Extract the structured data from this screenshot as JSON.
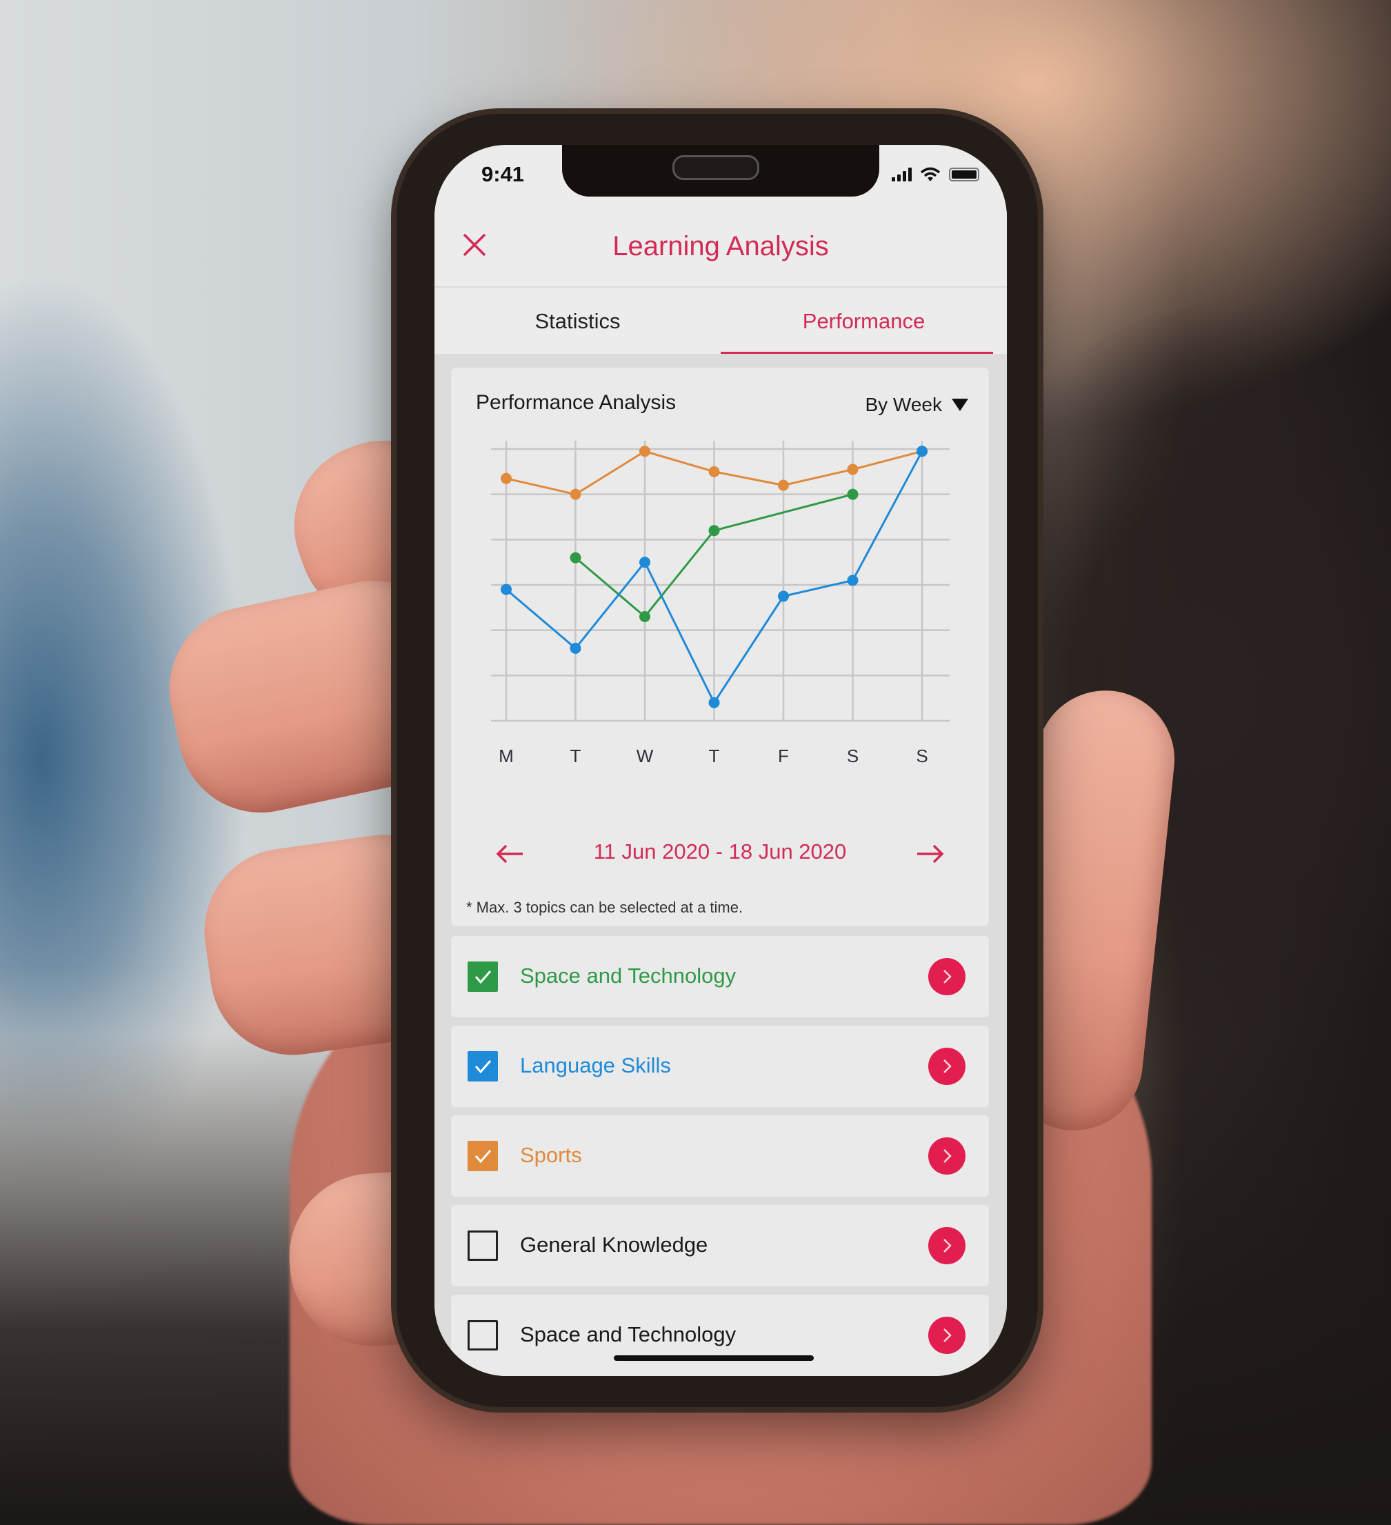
{
  "status_bar": {
    "time": "9:41"
  },
  "header": {
    "title": "Learning Analysis",
    "close_icon": "close-icon"
  },
  "tabs": [
    {
      "label": "Statistics",
      "active": false
    },
    {
      "label": "Performance",
      "active": true
    }
  ],
  "chart_card": {
    "title": "Performance Analysis",
    "range_select": {
      "selected": "By Week",
      "icon": "caret-down-icon"
    },
    "date_range": "11 Jun 2020 - 18 Jun 2020",
    "prev_icon": "arrow-left-icon",
    "next_icon": "arrow-right-icon",
    "note": "* Max. 3 topics can be selected at a time."
  },
  "colors": {
    "accent": "#d22b55",
    "button": "#e21d4f",
    "orange": "#e08a3c",
    "green": "#2f9a46",
    "blue": "#1f8ad8"
  },
  "chart_data": {
    "type": "line",
    "title": "Performance Analysis",
    "xlabel": "",
    "ylabel": "",
    "categories": [
      "M",
      "T",
      "W",
      "T",
      "F",
      "S",
      "S"
    ],
    "ylim": [
      0,
      6
    ],
    "grid": true,
    "y_tick_labels_shown": false,
    "series": [
      {
        "name": "Sports",
        "color": "#e08a3c",
        "values": [
          5.35,
          5.0,
          5.95,
          5.5,
          5.2,
          5.55,
          5.95
        ]
      },
      {
        "name": "Space and Technology",
        "color": "#2f9a46",
        "values": [
          null,
          3.6,
          2.3,
          4.2,
          null,
          5.0,
          null
        ]
      },
      {
        "name": "Language Skills",
        "color": "#1f8ad8",
        "values": [
          2.9,
          1.6,
          3.5,
          0.4,
          2.75,
          3.1,
          5.95
        ]
      }
    ]
  },
  "topics": [
    {
      "label": "Space and Technology",
      "checked": true,
      "color": "#2f9a46"
    },
    {
      "label": "Language Skills",
      "checked": true,
      "color": "#1f8ad8"
    },
    {
      "label": "Sports",
      "checked": true,
      "color": "#e08a3c"
    },
    {
      "label": "General Knowledge",
      "checked": false,
      "color": "#1a1a1a"
    },
    {
      "label": "Space and Technology",
      "checked": false,
      "color": "#1a1a1a"
    }
  ]
}
